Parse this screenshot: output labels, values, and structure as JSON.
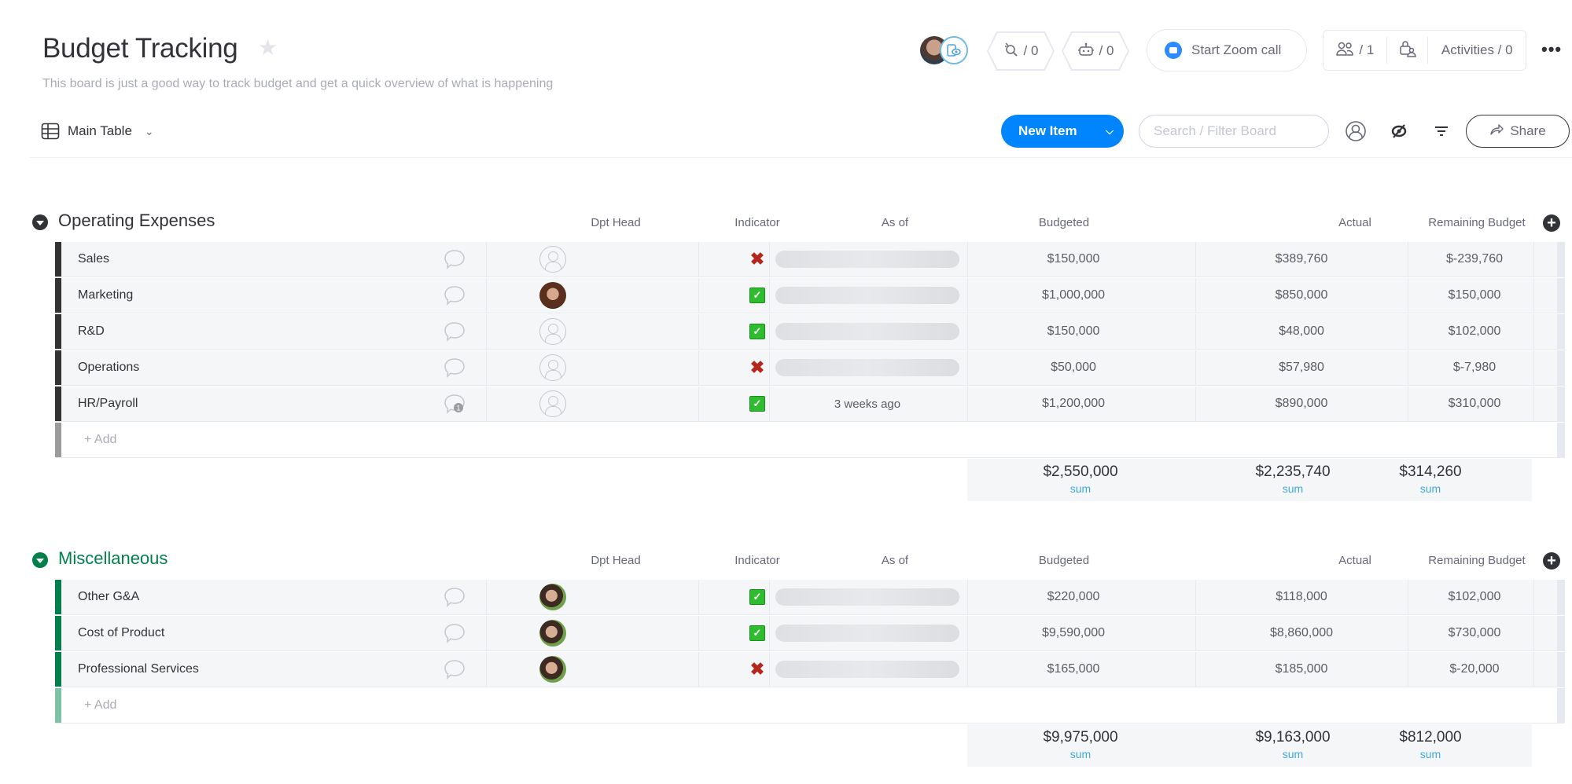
{
  "board": {
    "title": "Budget Tracking",
    "description": "This board is just a good way to track budget and get a quick overview of what is happening",
    "view_label": "Main Table"
  },
  "top_controls": {
    "integrations_count": "/ 0",
    "automations_count": "/ 0",
    "zoom_label": "Start Zoom call",
    "members_count": "/ 1",
    "activities_label": "Activities / 0",
    "more_label": "•••"
  },
  "toolbar": {
    "new_item_label": "New Item",
    "search_placeholder": "Search / Filter Board",
    "share_label": "Share"
  },
  "columns": {
    "dpt_head": "Dpt Head",
    "indicator": "Indicator",
    "as_of": "As of",
    "budgeted": "Budgeted",
    "actual": "Actual",
    "remaining": "Remaining Budget"
  },
  "colors": {
    "accent": "#0085ff",
    "group1": "#323338",
    "group2": "#037f4c",
    "indicator_ok": "#2ebd2e",
    "indicator_bad": "#b3271c",
    "sum_label": "#3fa9e0"
  },
  "groups": [
    {
      "title": "Operating Expenses",
      "color": "#333333",
      "add_label": "+ Add",
      "rows": [
        {
          "name": "Sales",
          "dpt_head": "empty",
          "indicator": "x",
          "as_of": "",
          "budgeted": "$150,000",
          "actual": "$389,760",
          "remaining": "$-239,760",
          "updates": ""
        },
        {
          "name": "Marketing",
          "dpt_head": "photo",
          "indicator": "check",
          "as_of": "",
          "budgeted": "$1,000,000",
          "actual": "$850,000",
          "remaining": "$150,000",
          "updates": ""
        },
        {
          "name": "R&D",
          "dpt_head": "empty",
          "indicator": "check",
          "as_of": "",
          "budgeted": "$150,000",
          "actual": "$48,000",
          "remaining": "$102,000",
          "updates": ""
        },
        {
          "name": "Operations",
          "dpt_head": "empty",
          "indicator": "x",
          "as_of": "",
          "budgeted": "$50,000",
          "actual": "$57,980",
          "remaining": "$-7,980",
          "updates": ""
        },
        {
          "name": "HR/Payroll",
          "dpt_head": "empty",
          "indicator": "check",
          "as_of": "3 weeks ago",
          "budgeted": "$1,200,000",
          "actual": "$890,000",
          "remaining": "$310,000",
          "updates": "1"
        }
      ],
      "sums": {
        "budgeted": "$2,550,000",
        "actual": "$2,235,740",
        "remaining": "$314,260",
        "label": "sum"
      }
    },
    {
      "title": "Miscellaneous",
      "color": "#037f4c",
      "add_label": "+ Add",
      "rows": [
        {
          "name": "Other G&A",
          "dpt_head": "photo",
          "indicator": "check",
          "as_of": "",
          "budgeted": "$220,000",
          "actual": "$118,000",
          "remaining": "$102,000",
          "updates": ""
        },
        {
          "name": "Cost of Product",
          "dpt_head": "photo",
          "indicator": "check",
          "as_of": "",
          "budgeted": "$9,590,000",
          "actual": "$8,860,000",
          "remaining": "$730,000",
          "updates": ""
        },
        {
          "name": "Professional Services",
          "dpt_head": "photo",
          "indicator": "x",
          "as_of": "",
          "budgeted": "$165,000",
          "actual": "$185,000",
          "remaining": "$-20,000",
          "updates": ""
        }
      ],
      "sums": {
        "budgeted": "$9,975,000",
        "actual": "$9,163,000",
        "remaining": "$812,000",
        "label": "sum"
      }
    }
  ]
}
